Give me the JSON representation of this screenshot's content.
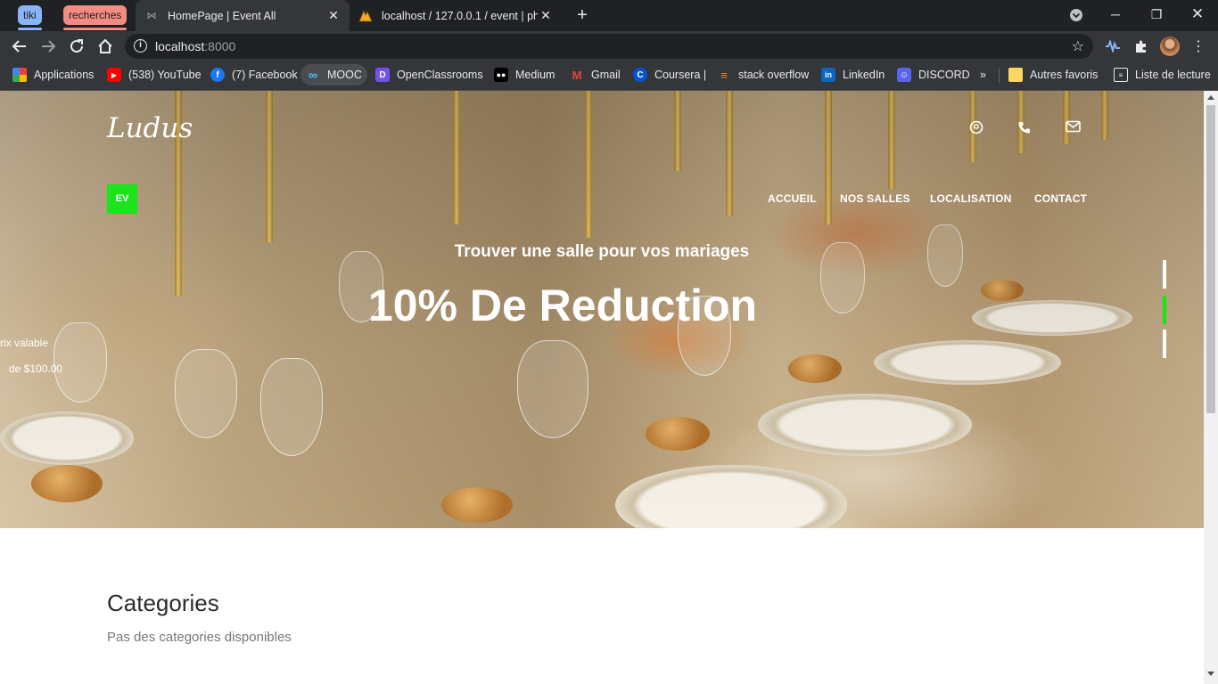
{
  "browser": {
    "tab_groups": [
      {
        "label": "tiki",
        "color": "#8ab4f8"
      },
      {
        "label": "recherches",
        "color": "#f28b82"
      }
    ],
    "tabs": [
      {
        "title": "HomePage | Event All",
        "active": true
      },
      {
        "title": "localhost / 127.0.0.1 / event | php",
        "active": false
      }
    ],
    "url": {
      "host": "localhost",
      "port": ":8000"
    },
    "bookmarks": [
      {
        "label": "Applications",
        "icon": "apps-grid-icon"
      },
      {
        "label": "(538) YouTube",
        "icon": "youtube-icon"
      },
      {
        "label": "(7) Facebook",
        "icon": "facebook-icon"
      },
      {
        "label": "MOOC",
        "icon": "infinity-icon"
      },
      {
        "label": "OpenClassrooms",
        "icon": "openclassrooms-icon"
      },
      {
        "label": "Medium",
        "icon": "medium-icon"
      },
      {
        "label": "Gmail",
        "icon": "gmail-icon"
      },
      {
        "label": "Coursera |",
        "icon": "coursera-icon"
      },
      {
        "label": "stack overflow",
        "icon": "stackoverflow-icon"
      },
      {
        "label": "LinkedIn",
        "icon": "linkedin-icon"
      },
      {
        "label": "DISCORD",
        "icon": "discord-icon"
      }
    ],
    "other_bookmarks": "Autres favoris",
    "reading_list": "Liste de lecture",
    "overflow": "»"
  },
  "site": {
    "logo": "Ludus",
    "badge": "EV",
    "menu": [
      "ACCUEIL",
      "NOS SALLES",
      "LOCALISATION",
      "CONTACT"
    ],
    "hero": {
      "subtitle": "Trouver une salle pour vos mariages",
      "headline": "10% De Reduction",
      "side_line1": "rix valable",
      "side_line2": "de $100.00"
    },
    "accent": "#1be41b",
    "categories": {
      "title": "Categories",
      "empty_text": "Pas des categories disponibles"
    }
  }
}
